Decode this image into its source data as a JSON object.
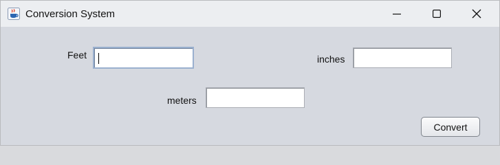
{
  "window": {
    "title": "Conversion System",
    "icon": "java-cup-icon"
  },
  "titlebar_buttons": {
    "minimize_icon": "minimize-icon",
    "maximize_icon": "maximize-icon",
    "close_icon": "close-icon"
  },
  "form": {
    "feet": {
      "label": "Feet",
      "value": ""
    },
    "inches": {
      "label": "inches",
      "value": ""
    },
    "meters": {
      "label": "meters",
      "value": ""
    },
    "convert_label": "Convert"
  },
  "colors": {
    "window_bg": "#d6d9e0",
    "titlebar_bg": "#eceef1",
    "focus_border": "#9ab0cf"
  }
}
